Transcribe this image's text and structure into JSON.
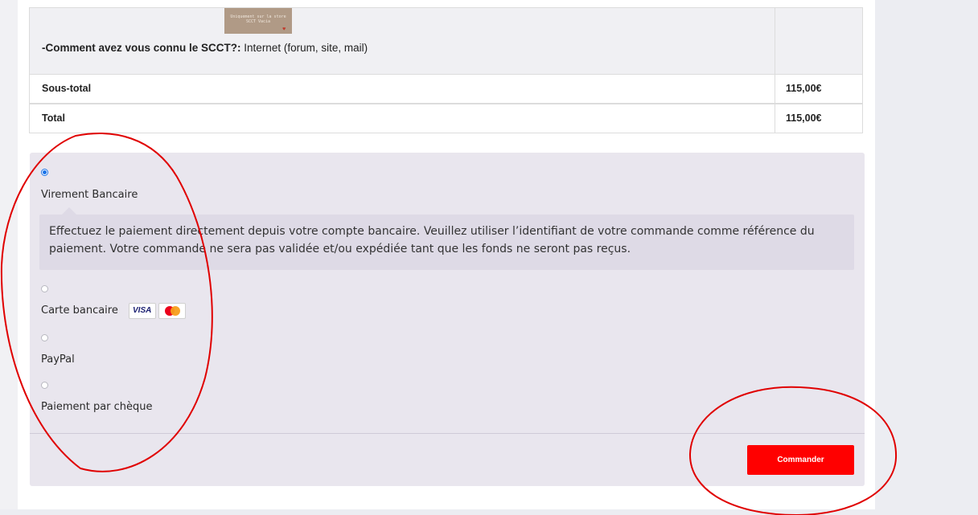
{
  "order": {
    "thumbnail_caption": "Uniquement sur la store SCCT Vacia",
    "referral_label": "-Comment avez vous connu le SCCT?:",
    "referral_value": "Internet (forum, site, mail)",
    "subtotal_label": "Sous-total",
    "subtotal_value": "115,00€",
    "total_label": "Total",
    "total_value": "115,00€"
  },
  "payment": {
    "methods": [
      {
        "label": "Virement Bancaire",
        "selected": true
      },
      {
        "label": "Carte bancaire",
        "selected": false
      },
      {
        "label": "PayPal",
        "selected": false
      },
      {
        "label": "Paiement par chèque",
        "selected": false
      }
    ],
    "bank_transfer_description": "Effectuez le paiement directement depuis votre compte bancaire. Veuillez utiliser l’identifiant de votre commande comme référence du paiement. Votre commande ne sera pas validée et/ou expédiée tant que les fonds ne seront pas reçus.",
    "card_logos": [
      "VISA",
      "mastercard-icon"
    ],
    "submit_label": "Commander"
  },
  "colors": {
    "accent": "#ff0000",
    "panel_bg": "#e9e6ee",
    "description_bg": "#dedae6",
    "annotation": "#e00000",
    "radio_checked": "#1a73e8"
  }
}
